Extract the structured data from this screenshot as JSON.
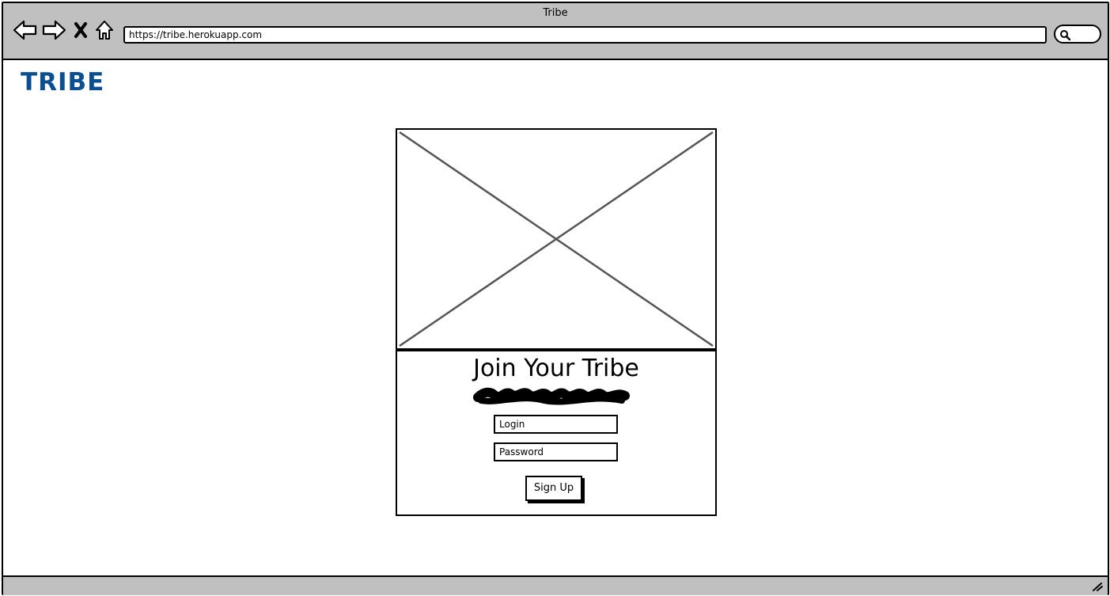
{
  "window": {
    "title": "Tribe"
  },
  "browser": {
    "url": "https://tribe.herokuapp.com",
    "icons": [
      "back-arrow-icon",
      "forward-arrow-icon",
      "close-x-icon",
      "home-icon",
      "search-icon"
    ]
  },
  "header": {
    "logo": "TRIBE",
    "logo_color": "#0b4f91"
  },
  "main": {
    "image_placeholder": "image-placeholder-icon",
    "form": {
      "title": "Join Your Tribe",
      "login_value": "Login",
      "password_value": "Password",
      "signup_label": "Sign Up"
    }
  },
  "colors": {
    "chrome": "#c0c0c0",
    "border": "#000000"
  }
}
